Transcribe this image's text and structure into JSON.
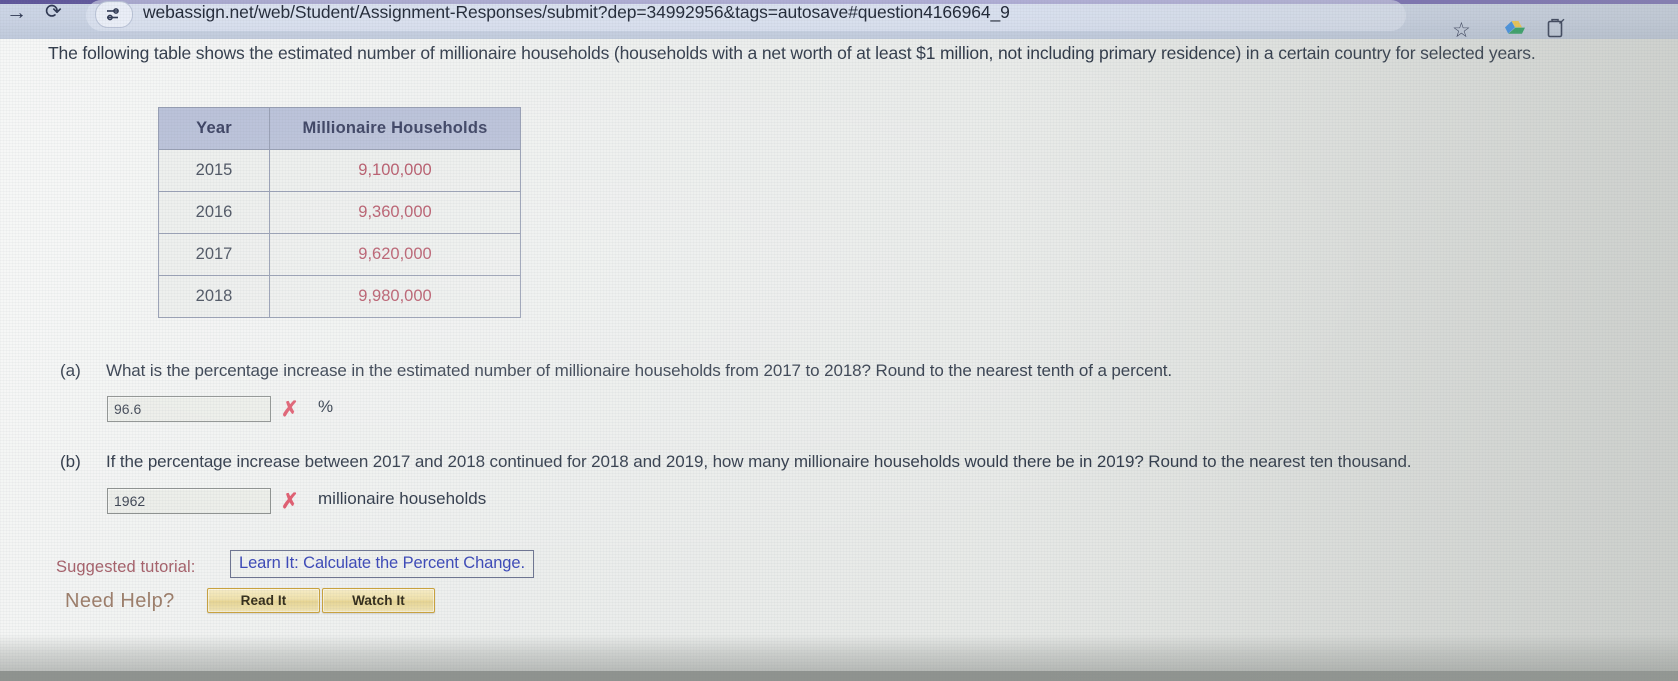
{
  "browser": {
    "url": "webassign.net/web/Student/Assignment-Responses/submit?dep=34992956&tags=autosave#question4166964_9",
    "forward_icon": "forward-arrow-icon",
    "reload_icon": "reload-icon",
    "site_info_icon": "site-settings-icon",
    "bookmark_icon": "star-icon",
    "drive_icon": "google-drive-icon",
    "extension_icon": "extension-icon"
  },
  "question": {
    "prompt": "The following table shows the estimated number of millionaire households (households with a net worth of at least $1 million, not including primary residence) in a certain country for selected years."
  },
  "table": {
    "headers": [
      "Year",
      "Millionaire Households"
    ],
    "rows": [
      {
        "year": "2015",
        "households": "9,100,000"
      },
      {
        "year": "2016",
        "households": "9,360,000"
      },
      {
        "year": "2017",
        "households": "9,620,000"
      },
      {
        "year": "2018",
        "households": "9,980,000"
      }
    ]
  },
  "parts": [
    {
      "label": "(a)",
      "text": "What is the percentage increase in the estimated number of millionaire households from 2017 to 2018? Round to the nearest tenth of a percent.",
      "answer_value": "96.6",
      "status": "incorrect",
      "status_glyph": "✗",
      "unit": "%"
    },
    {
      "label": "(b)",
      "text": "If the percentage increase between 2017 and 2018 continued for 2018 and 2019, how many millionaire households would there be in 2019? Round to the nearest ten thousand.",
      "answer_value": "1962",
      "status": "incorrect",
      "status_glyph": "✗",
      "unit": "millionaire households"
    }
  ],
  "tutorial": {
    "label": "Suggested tutorial:",
    "link_text": "Learn It: Calculate the Percent Change."
  },
  "help": {
    "title": "Need Help?",
    "read_button": "Read It",
    "watch_button": "Watch It"
  },
  "colors": {
    "table_header_bg": "#b5bdd6",
    "table_value_text": "#b1495c",
    "incorrect_mark": "#e0576b",
    "link": "#3a47b8",
    "tutorial_label": "#a6616b",
    "help_button_bg": "#efe0a9"
  }
}
